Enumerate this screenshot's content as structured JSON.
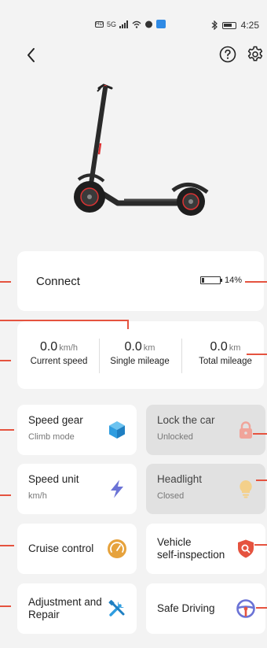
{
  "status_bar": {
    "time": "4:25",
    "network": "5G"
  },
  "connect": {
    "label": "Connect",
    "battery_percent": "14%",
    "battery_level": 0.14
  },
  "stats": [
    {
      "value": "0.0",
      "unit": "km/h",
      "label": "Current speed"
    },
    {
      "value": "0.0",
      "unit": "km",
      "label": "Single mileage"
    },
    {
      "value": "0.0",
      "unit": "km",
      "label": "Total mileage"
    }
  ],
  "tiles": {
    "speed_gear": {
      "title": "Speed gear",
      "sub": "Climb mode"
    },
    "lock_car": {
      "title": "Lock the car",
      "sub": "Unlocked"
    },
    "speed_unit": {
      "title": "Speed unit",
      "sub": "km/h"
    },
    "headlight": {
      "title": "Headlight",
      "sub": "Closed"
    },
    "cruise": {
      "title": "Cruise control"
    },
    "inspection": {
      "title_line1": "Vehicle",
      "title_line2": "self-inspection"
    },
    "adjustment": {
      "title_line1": "Adjustment and",
      "title_line2": "Repair"
    },
    "safe_driving": {
      "title": "Safe Driving"
    }
  },
  "colors": {
    "accent_red": "#e5533f",
    "icon_blue": "#2f9de0",
    "icon_purple": "#6b73d6",
    "icon_orange": "#e6a23c"
  }
}
